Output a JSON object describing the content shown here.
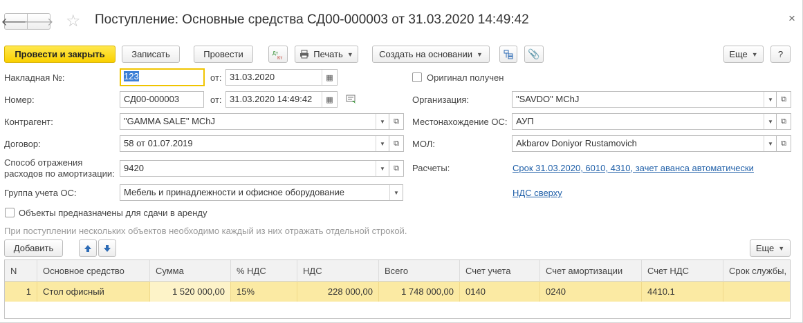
{
  "window": {
    "title": "Поступление: Основные средства СД00-000003 от 31.03.2020 14:49:42"
  },
  "toolbar": {
    "post_and_close": "Провести и закрыть",
    "save": "Записать",
    "post": "Провести",
    "dt_kt_icon": "Дт Кт",
    "print": "Печать",
    "create_based_on": "Создать на основании",
    "more": "Еще",
    "help": "?"
  },
  "form": {
    "invoice_label": "Накладная №:",
    "invoice_value": "123",
    "invoice_date_label": "от:",
    "invoice_date": "31.03.2020",
    "number_label": "Номер:",
    "number_value": "СД00-000003",
    "number_date_label": "от:",
    "number_date": "31.03.2020 14:49:42",
    "counterparty_label": "Контрагент:",
    "counterparty_value": "\"GAMMA SALE\" MChJ",
    "contract_label": "Договор:",
    "contract_value": "58 от 01.07.2019",
    "amortization_label_line1": "Способ отражения",
    "amortization_label_line2": "расходов по амортизации:",
    "amortization_value": "9420",
    "group_label": "Группа учета ОС:",
    "group_value": "Мебель и принадлежности и офисное оборудование",
    "original_received_label": "Оригинал получен",
    "organization_label": "Организация:",
    "organization_value": "\"SAVDO\" MChJ",
    "location_label": "Местонахождение ОС:",
    "location_value": "АУП",
    "mol_label": "МОЛ:",
    "mol_value": "Akbarov Doniyor Rustamovich",
    "settlements_label": "Расчеты:",
    "settlements_link": "Срок 31.03.2020, 6010, 4310, зачет аванса автоматически",
    "vat_link": "НДС сверху",
    "rent_label": "Объекты предназначены для сдачи в аренду",
    "hint": "При поступлении нескольких объектов необходимо каждый из них отражать отдельной строкой."
  },
  "table_toolbar": {
    "add": "Добавить",
    "more": "Еще"
  },
  "table": {
    "columns": [
      "N",
      "Основное средство",
      "Сумма",
      "% НДС",
      "НДС",
      "Всего",
      "Счет учета",
      "Счет амортизации",
      "Счет НДС",
      "Срок службы,"
    ],
    "rows": [
      [
        "1",
        "Стол офисный",
        "1 520 000,00",
        "15%",
        "228 000,00",
        "1 748 000,00",
        "0140",
        "0240",
        "4410.1",
        ""
      ]
    ]
  },
  "colors": {
    "primary_button": "#fad000",
    "selected_row": "#fbeaa3",
    "link": "#1f5fa8"
  }
}
